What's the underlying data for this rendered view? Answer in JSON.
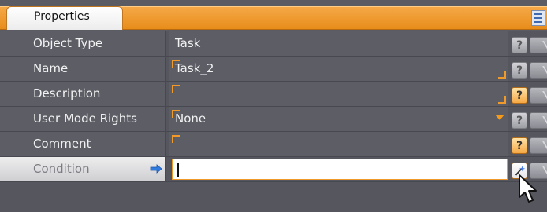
{
  "panel": {
    "tab_label": "Properties"
  },
  "properties": [
    {
      "label": "Object Type",
      "value": "Task",
      "help": "grey"
    },
    {
      "label": "Name",
      "value": "Task_2",
      "help": "grey"
    },
    {
      "label": "Description",
      "value": "",
      "help": "orange"
    },
    {
      "label": "User Mode Rights",
      "value": "None",
      "help": "grey"
    },
    {
      "label": "Comment",
      "value": "",
      "help": "orange"
    },
    {
      "label": "Condition",
      "value": "",
      "help": "wand"
    }
  ],
  "icons": {
    "header": "grid-view-icon",
    "help": "help-question-icon",
    "nav": "navigate-arrow-icon",
    "condition_arrow": "right-arrow-icon",
    "wand": "magic-wand-icon",
    "cursor": "mouse-pointer-icon"
  },
  "colors": {
    "accent": "#f09a2c",
    "header": "#e88d1b",
    "background": "#55565e",
    "row": "#5c5d65",
    "text": "#f2f2f2"
  }
}
